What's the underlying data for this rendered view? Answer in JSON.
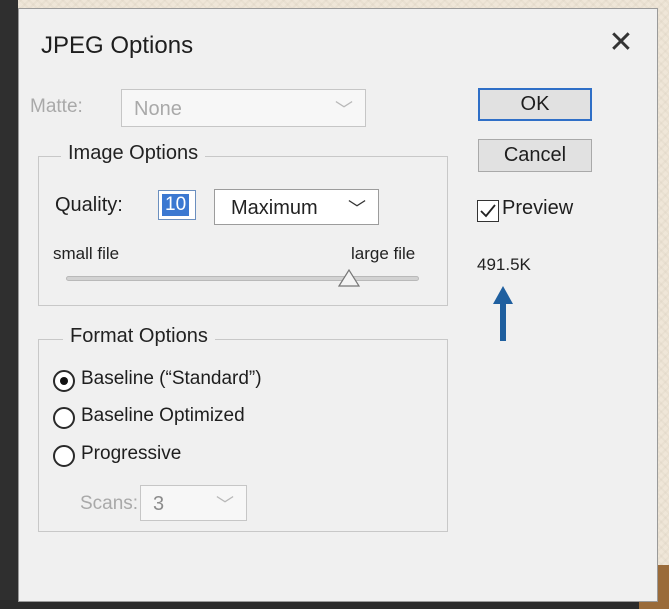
{
  "dialog": {
    "title": "JPEG Options",
    "close_icon": "close-icon"
  },
  "matte": {
    "label": "Matte:",
    "value": "None",
    "enabled": false
  },
  "image_options": {
    "group_title": "Image Options",
    "quality_label": "Quality:",
    "quality_value": "10",
    "quality_preset": "Maximum",
    "small_file_label": "small file",
    "large_file_label": "large file",
    "quality_level": 10,
    "quality_max": 12
  },
  "format_options": {
    "group_title": "Format Options",
    "options": [
      {
        "label": "Baseline (“Standard”)",
        "selected": true
      },
      {
        "label": "Baseline Optimized",
        "selected": false
      },
      {
        "label": "Progressive",
        "selected": false
      }
    ],
    "scans_label": "Scans:",
    "scans_value": "3"
  },
  "buttons": {
    "ok": "OK",
    "cancel": "Cancel"
  },
  "preview": {
    "label": "Preview",
    "checked": true,
    "file_size": "491.5K"
  },
  "colors": {
    "accent": "#2f6fc7",
    "annotation_arrow": "#1f5f9f",
    "selection": "#3b78d1"
  }
}
